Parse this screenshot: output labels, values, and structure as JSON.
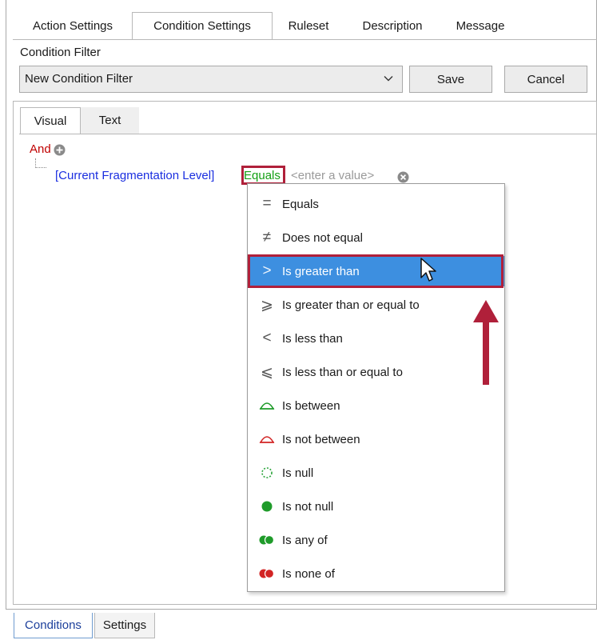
{
  "top_tabs": [
    {
      "label": "Action Settings"
    },
    {
      "label": "Condition Settings",
      "active": true
    },
    {
      "label": "Ruleset"
    },
    {
      "label": "Description"
    },
    {
      "label": "Message"
    }
  ],
  "condition_filter": {
    "label": "Condition Filter",
    "value": "New Condition Filter",
    "save_label": "Save",
    "cancel_label": "Cancel"
  },
  "inner_tabs": [
    {
      "label": "Visual",
      "active": true
    },
    {
      "label": "Text"
    }
  ],
  "tree": {
    "group_label": "And",
    "field": "[Current Fragmentation Level]",
    "operator": "Equals",
    "value_placeholder": "<enter a value>"
  },
  "operator_menu": {
    "selected_index": 2,
    "items": [
      {
        "label": "Equals",
        "icon": "equals-icon"
      },
      {
        "label": "Does not equal",
        "icon": "not-equal-icon"
      },
      {
        "label": "Is greater than",
        "icon": "greater-than-icon"
      },
      {
        "label": "Is greater than or equal to",
        "icon": "greater-equal-icon"
      },
      {
        "label": "Is less than",
        "icon": "less-than-icon"
      },
      {
        "label": "Is less than or equal to",
        "icon": "less-equal-icon"
      },
      {
        "label": "Is between",
        "icon": "between-icon"
      },
      {
        "label": "Is not between",
        "icon": "not-between-icon"
      },
      {
        "label": "Is null",
        "icon": "null-icon"
      },
      {
        "label": "Is not null",
        "icon": "not-null-icon"
      },
      {
        "label": "Is any of",
        "icon": "any-of-icon"
      },
      {
        "label": "Is none of",
        "icon": "none-of-icon"
      }
    ]
  },
  "bottom_tabs": [
    {
      "label": "Conditions",
      "active": true
    },
    {
      "label": "Settings"
    }
  ],
  "colors": {
    "group_red": "#c00000",
    "field_blue": "#1a2ee0",
    "operator_green": "#14a014",
    "selection_blue": "#3d8fe0",
    "annotation_red": "#b0203a"
  }
}
